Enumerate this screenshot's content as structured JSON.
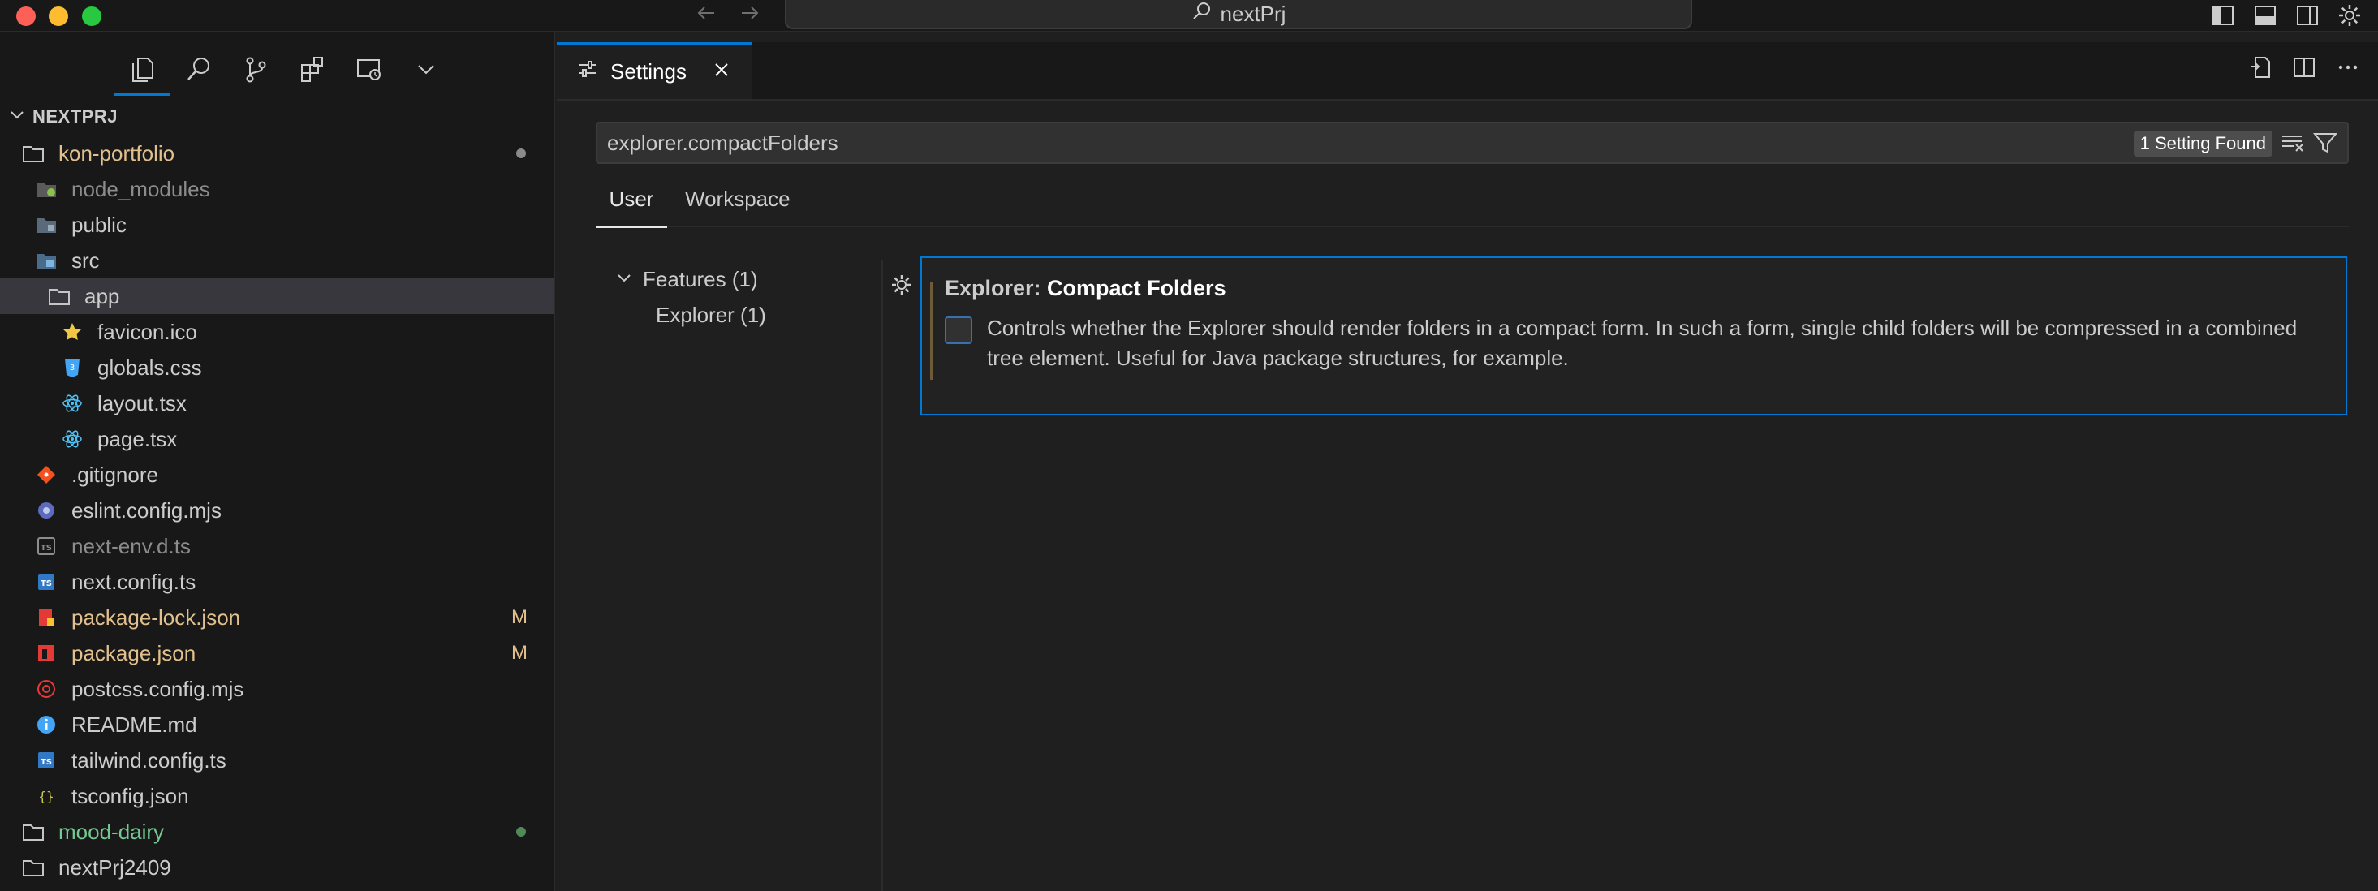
{
  "titlebar": {
    "search_text": "nextPrj"
  },
  "sidebar": {
    "title": "NEXTPRJ",
    "tree": [
      {
        "label": "kon-portfolio",
        "indent": 0,
        "kind": "folder",
        "color": "#e2c08d",
        "decoration": "dot",
        "deco_color": "#8a8a8a"
      },
      {
        "label": "node_modules",
        "indent": 1,
        "kind": "node-modules",
        "color": "#8c8c8c"
      },
      {
        "label": "public",
        "indent": 1,
        "kind": "public",
        "color": "#cccccc"
      },
      {
        "label": "src",
        "indent": 1,
        "kind": "src",
        "color": "#cccccc"
      },
      {
        "label": "app",
        "indent": 2,
        "kind": "folder-open",
        "color": "#cccccc",
        "selected": true
      },
      {
        "label": "favicon.ico",
        "indent": 3,
        "kind": "star",
        "color": "#cccccc"
      },
      {
        "label": "globals.css",
        "indent": 3,
        "kind": "css",
        "color": "#cccccc"
      },
      {
        "label": "layout.tsx",
        "indent": 3,
        "kind": "react",
        "color": "#cccccc"
      },
      {
        "label": "page.tsx",
        "indent": 3,
        "kind": "react",
        "color": "#cccccc"
      },
      {
        "label": ".gitignore",
        "indent": 1,
        "kind": "git",
        "color": "#cccccc"
      },
      {
        "label": "eslint.config.mjs",
        "indent": 1,
        "kind": "eslint",
        "color": "#cccccc"
      },
      {
        "label": "next-env.d.ts",
        "indent": 1,
        "kind": "ts-gray",
        "color": "#8c8c8c"
      },
      {
        "label": "next.config.ts",
        "indent": 1,
        "kind": "ts",
        "color": "#cccccc"
      },
      {
        "label": "package-lock.json",
        "indent": 1,
        "kind": "lock",
        "color": "#e2c08d",
        "decoration": "M"
      },
      {
        "label": "package.json",
        "indent": 1,
        "kind": "npm",
        "color": "#e2c08d",
        "decoration": "M"
      },
      {
        "label": "postcss.config.mjs",
        "indent": 1,
        "kind": "postcss",
        "color": "#cccccc"
      },
      {
        "label": "README.md",
        "indent": 1,
        "kind": "info",
        "color": "#cccccc"
      },
      {
        "label": "tailwind.config.ts",
        "indent": 1,
        "kind": "ts",
        "color": "#cccccc"
      },
      {
        "label": "tsconfig.json",
        "indent": 1,
        "kind": "json",
        "color": "#cccccc"
      },
      {
        "label": "mood-dairy",
        "indent": 0,
        "kind": "folder",
        "color": "#73c991",
        "decoration": "dot",
        "deco_color": "#4f8a57"
      },
      {
        "label": "nextPrj2409",
        "indent": 0,
        "kind": "folder",
        "color": "#cccccc"
      }
    ]
  },
  "editor": {
    "tab_label": "Settings",
    "search_value": "explorer.compactFolders",
    "found_label": "1 Setting Found",
    "scope_user": "User",
    "scope_workspace": "Workspace",
    "toc_features": "Features (1)",
    "toc_explorer": "Explorer (1)",
    "setting": {
      "category": "Explorer: ",
      "name": "Compact Folders",
      "description": "Controls whether the Explorer should render folders in a compact form. In such a form, single child folders will be compressed in a combined tree element. Useful for Java package structures, for example."
    }
  },
  "colors": {
    "accent": "#0078d4",
    "modified": "#e2c08d",
    "untracked": "#73c991"
  }
}
